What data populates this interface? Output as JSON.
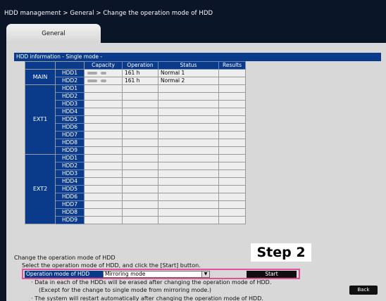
{
  "breadcrumb": "HDD management > General > Change the operation mode of HDD",
  "tab": "General",
  "section_header": "HDD information  - Single mode -",
  "table": {
    "headers": {
      "capacity": "Capacity",
      "operation": "Operation",
      "status": "Status",
      "results": "Results"
    },
    "groups": [
      {
        "name": "MAIN",
        "rows": [
          {
            "drive": "HDD1",
            "operation": "161 h",
            "status": "Normal 1",
            "results": ""
          },
          {
            "drive": "HDD2",
            "operation": "161 h",
            "status": "Normal 2",
            "results": ""
          }
        ]
      },
      {
        "name": "EXT1",
        "rows": [
          {
            "drive": "HDD1"
          },
          {
            "drive": "HDD2"
          },
          {
            "drive": "HDD3"
          },
          {
            "drive": "HDD4"
          },
          {
            "drive": "HDD5"
          },
          {
            "drive": "HDD6"
          },
          {
            "drive": "HDD7"
          },
          {
            "drive": "HDD8"
          },
          {
            "drive": "HDD9"
          }
        ]
      },
      {
        "name": "EXT2",
        "rows": [
          {
            "drive": "HDD1"
          },
          {
            "drive": "HDD2"
          },
          {
            "drive": "HDD3"
          },
          {
            "drive": "HDD4"
          },
          {
            "drive": "HDD5"
          },
          {
            "drive": "HDD6"
          },
          {
            "drive": "HDD7"
          },
          {
            "drive": "HDD8"
          },
          {
            "drive": "HDD9"
          }
        ]
      }
    ]
  },
  "change": {
    "title": "Change the operation mode of HDD",
    "instruction": "Select the operation mode of HDD, and click the [Start] button.",
    "label": "Operation mode of HDD",
    "select_value": "Mirroring mode",
    "start": "Start"
  },
  "step_label": "Step 2",
  "notes": {
    "n1": "· Data in each of the HDDs will be erased after changing the operation mode of HDD.",
    "n2": "(Except for the change to single mode from mirroring mode.)",
    "n3": "· The system will restart automatically after changing the operation mode of HDD."
  },
  "back": "Back",
  "colors": {
    "header_blue": "#0a3a8a",
    "highlight_pink": "#e0509b",
    "background": "#0a1528"
  }
}
